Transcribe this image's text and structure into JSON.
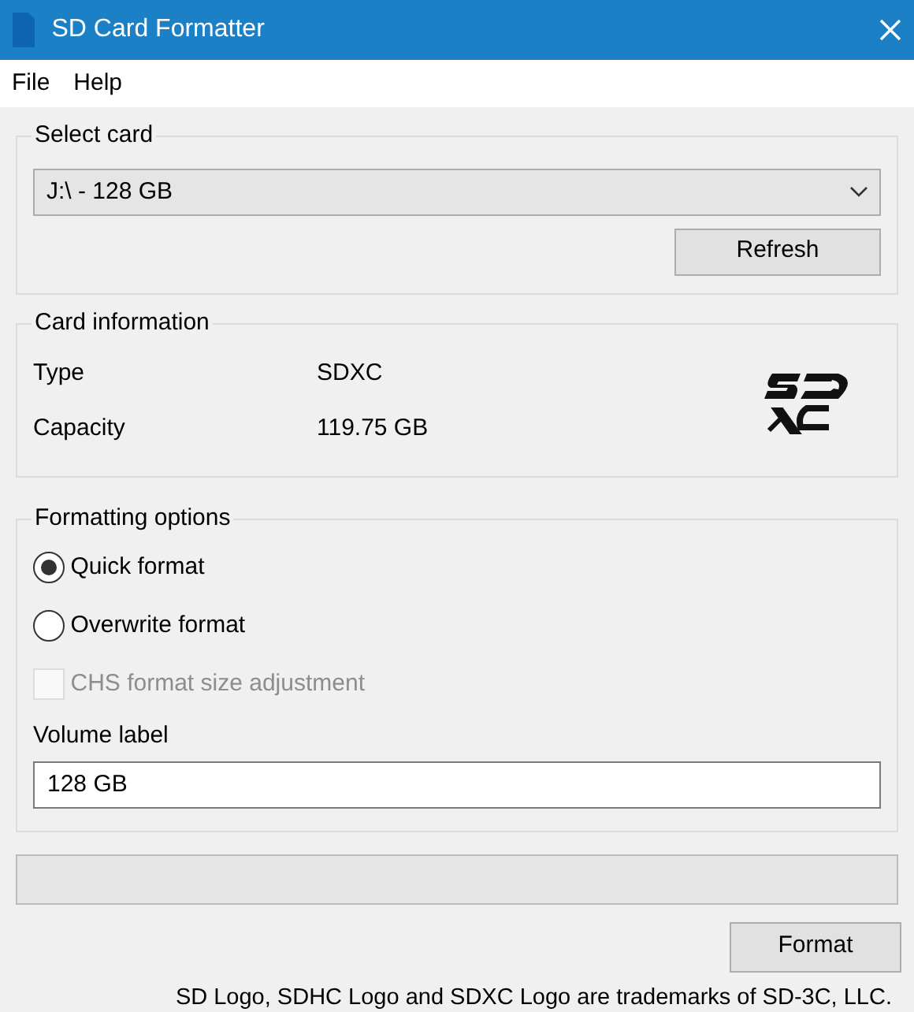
{
  "window": {
    "title": "SD Card Formatter"
  },
  "menu": [
    {
      "label": "File"
    },
    {
      "label": "Help"
    }
  ],
  "select_card": {
    "title": "Select card",
    "drive": "J:\\ - 128 GB",
    "refresh_button": "Refresh"
  },
  "card_information": {
    "title": "Card information",
    "rows": [
      {
        "label": "Type",
        "value": "SDXC"
      },
      {
        "label": "Capacity",
        "value": "119.75 GB"
      }
    ]
  },
  "formatting_options": {
    "title": "Formatting options",
    "options": [
      {
        "kind": "radio",
        "label": "Quick format",
        "selected": true,
        "disabled": false
      },
      {
        "kind": "radio",
        "label": "Overwrite format",
        "selected": false,
        "disabled": false
      },
      {
        "kind": "checkbox",
        "label": "CHS format size adjustment",
        "checked": false,
        "disabled": true
      }
    ],
    "volume_label": {
      "label": "Volume label",
      "value": "128 GB"
    }
  },
  "progress": {
    "level": 0
  },
  "format_button": "Format",
  "footer": "SD Logo, SDHC Logo and SDXC Logo are trademarks of SD-3C, LLC."
}
